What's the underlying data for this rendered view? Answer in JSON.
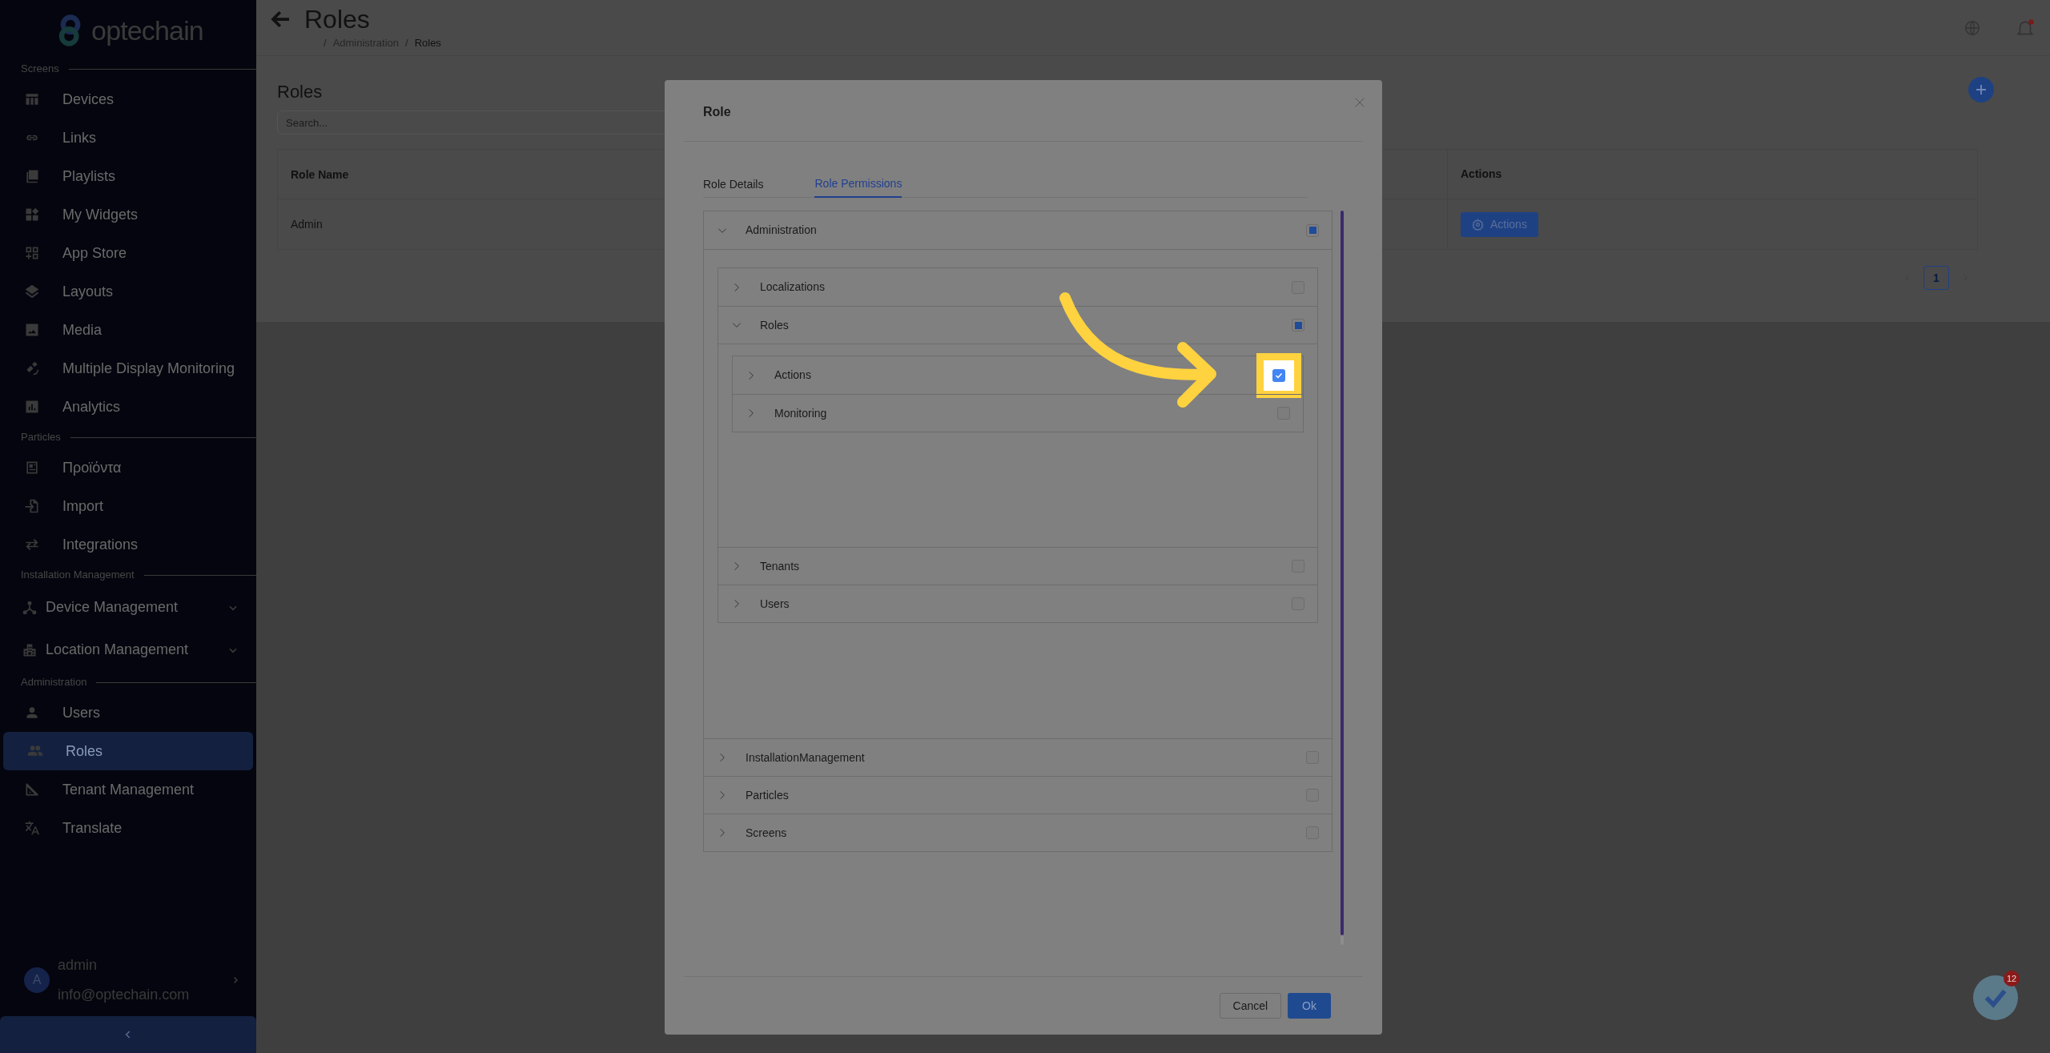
{
  "sidebar": {
    "logo": "optechain",
    "sections": [
      {
        "title": "Screens",
        "items": [
          {
            "label": "Devices",
            "kind": "link",
            "selected": false
          },
          {
            "label": "Links",
            "kind": "link",
            "selected": false
          },
          {
            "label": "Playlists",
            "kind": "link",
            "selected": false
          },
          {
            "label": "My Widgets",
            "kind": "link",
            "selected": false
          },
          {
            "label": "App Store",
            "kind": "link",
            "selected": false
          },
          {
            "label": "Layouts",
            "kind": "link",
            "selected": false
          },
          {
            "label": "Media",
            "kind": "link",
            "selected": false
          },
          {
            "label": "Multiple Display Monitoring",
            "kind": "link",
            "selected": false
          },
          {
            "label": "Analytics",
            "kind": "link",
            "selected": false
          }
        ]
      },
      {
        "title": "Particles",
        "items": [
          {
            "label": "Προϊόντα",
            "kind": "link",
            "selected": false
          },
          {
            "label": "Import",
            "kind": "link",
            "selected": false
          },
          {
            "label": "Integrations",
            "kind": "link",
            "selected": false
          }
        ]
      },
      {
        "title": "Installation Management",
        "items": [
          {
            "label": "Device Management",
            "kind": "group",
            "selected": false
          },
          {
            "label": "Location Management",
            "kind": "group",
            "selected": false
          }
        ]
      },
      {
        "title": "Administration",
        "items": [
          {
            "label": "Users",
            "kind": "link",
            "selected": false
          },
          {
            "label": "Roles",
            "kind": "link",
            "selected": true
          },
          {
            "label": "Tenant Management",
            "kind": "link",
            "selected": false
          },
          {
            "label": "Translate",
            "kind": "link",
            "selected": false
          }
        ]
      }
    ],
    "user": {
      "avatar": "A",
      "name": "admin",
      "email": "info@optechain.com"
    }
  },
  "header": {
    "title": "Roles",
    "separator": "/",
    "breadcrumb": [
      "Administration",
      "Roles"
    ]
  },
  "card": {
    "title": "Roles",
    "search": {
      "placeholder": "Search..."
    },
    "table": {
      "columns": [
        "Role Name",
        "Actions"
      ],
      "rows": [
        {
          "role_name": "Admin",
          "action_button": "Actions"
        }
      ]
    },
    "pages": [
      {
        "label": "1",
        "selected": true
      }
    ]
  },
  "modal": {
    "title": "Role",
    "tabs": [
      {
        "label": "Role Details",
        "selected": false
      },
      {
        "label": "Role Permissions",
        "selected": true
      }
    ],
    "tree": [
      {
        "label": "Administration",
        "checked": false,
        "partial": true,
        "expanded": true,
        "children": [
          {
            "label": "Localizations",
            "checked": false,
            "partial": false,
            "expanded": false
          },
          {
            "label": "Roles",
            "checked": false,
            "partial": true,
            "expanded": true,
            "children": [
              {
                "label": "Actions",
                "checked": true,
                "partial": false,
                "expanded": false,
                "highlighted": true
              },
              {
                "label": "Monitoring",
                "checked": false,
                "partial": false,
                "expanded": false
              }
            ]
          },
          {
            "label": "Tenants",
            "checked": false,
            "partial": false,
            "expanded": false
          },
          {
            "label": "Users",
            "checked": false,
            "partial": false,
            "expanded": false
          }
        ]
      },
      {
        "label": "InstallationManagement",
        "checked": false,
        "partial": false,
        "expanded": false
      },
      {
        "label": "Particles",
        "checked": false,
        "partial": false,
        "expanded": false
      },
      {
        "label": "Screens",
        "checked": false,
        "partial": false,
        "expanded": false
      }
    ],
    "buttons": [
      {
        "label": "Cancel",
        "kind": "secondary"
      },
      {
        "label": "Ok",
        "kind": "primary"
      }
    ]
  },
  "help_badge": "12"
}
